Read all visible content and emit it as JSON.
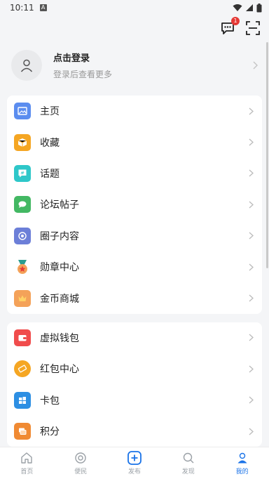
{
  "status": {
    "time": "10:11",
    "notification_letter": "A"
  },
  "header": {
    "message_badge": "1"
  },
  "profile": {
    "name": "点击登录",
    "subtitle": "登录后查看更多"
  },
  "menu_group1": [
    {
      "label": "主页",
      "icon": "image-icon",
      "color": "#5b8def"
    },
    {
      "label": "收藏",
      "icon": "box-icon",
      "color": "#f5a623"
    },
    {
      "label": "话题",
      "icon": "hash-icon",
      "color": "#2ec7c9"
    },
    {
      "label": "论坛帖子",
      "icon": "chat-icon",
      "color": "#43b863"
    },
    {
      "label": "圈子内容",
      "icon": "circle-icon",
      "color": "#6c7fd8"
    },
    {
      "label": "勋章中心",
      "icon": "medal-icon",
      "color": "#e0592a"
    },
    {
      "label": "金币商城",
      "icon": "crown-icon",
      "color": "#f4a259"
    }
  ],
  "menu_group2": [
    {
      "label": "虚拟钱包",
      "icon": "wallet-icon",
      "color": "#f04c4c"
    },
    {
      "label": "红包中心",
      "icon": "coupon-icon",
      "color": "#f5a623"
    },
    {
      "label": "卡包",
      "icon": "cards-icon",
      "color": "#2d8fe3"
    },
    {
      "label": "积分",
      "icon": "points-icon",
      "color": "#f08a33"
    }
  ],
  "tabs": [
    {
      "label": "首页",
      "icon": "home-icon",
      "active": false
    },
    {
      "label": "便民",
      "icon": "compass-icon",
      "active": false
    },
    {
      "label": "发布",
      "icon": "plus-box-icon",
      "active": false
    },
    {
      "label": "发现",
      "icon": "search-icon",
      "active": false
    },
    {
      "label": "我的",
      "icon": "user-icon",
      "active": true
    }
  ],
  "colors": {
    "accent": "#1a73e8",
    "badge": "#e53935"
  }
}
